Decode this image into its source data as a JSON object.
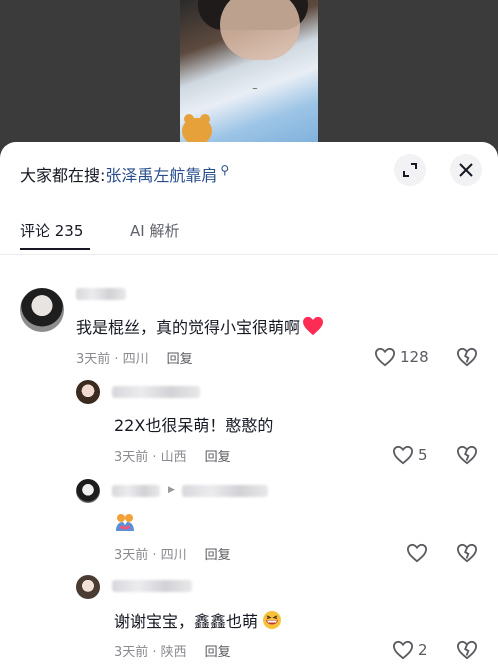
{
  "header": {
    "search_prefix": "大家都在搜: ",
    "search_term": "张泽禹左航靠肩",
    "search_icon": "search-icon",
    "expand_icon": "expand-icon",
    "close_icon": "close-icon"
  },
  "tabs": [
    {
      "label": "评论 235",
      "active": true
    },
    {
      "label": "AI 解析",
      "active": false
    }
  ],
  "comments": [
    {
      "text": "我是棍丝，真的觉得小宝很萌啊",
      "emoji": "red-heart",
      "meta": "3天前 · 四川",
      "reply": "回复",
      "likes": "128"
    },
    {
      "text": "22X也很呆萌！憨憨的",
      "meta": "3天前 · 山西",
      "reply": "回复",
      "likes": "5"
    },
    {
      "text": "",
      "emoji": "hugging-couple",
      "meta": "3天前 · 四川",
      "reply": "回复",
      "likes": ""
    },
    {
      "text": "谢谢宝宝，鑫鑫也萌",
      "emoji": "grinning-face",
      "meta": "3天前 · 陕西",
      "reply": "回复",
      "likes": "2"
    }
  ],
  "colors": {
    "accent_link": "#2a4e8c",
    "heart": "#fe2c55",
    "text_primary": "#161823",
    "text_meta": "#8a8b91"
  }
}
